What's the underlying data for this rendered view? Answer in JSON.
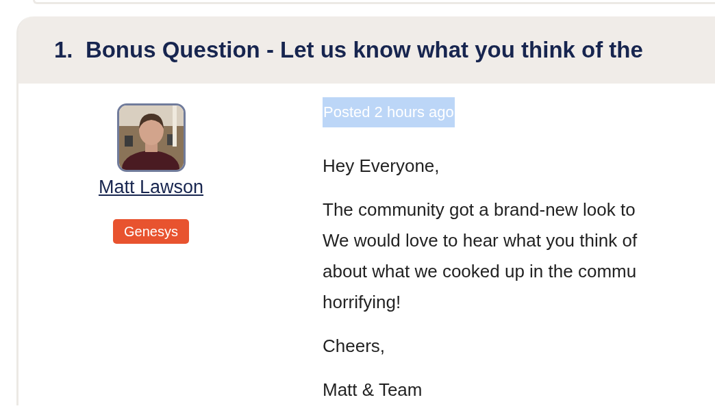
{
  "question": {
    "number": "1.",
    "title": "Bonus Question - Let us know what you think of the"
  },
  "author": {
    "name": "Matt Lawson",
    "badge": "Genesys"
  },
  "posted": {
    "text": "Posted 2 hours ago",
    "selected": true
  },
  "body": [
    {
      "lines": [
        "Hey Everyone,"
      ]
    },
    {
      "lines": [
        "The community got a brand-new look to",
        "We would love to hear what you think of",
        "about what we cooked up in the commu",
        "horrifying!"
      ]
    },
    {
      "lines": [
        "Cheers,"
      ]
    },
    {
      "lines": [
        "Matt & Team"
      ]
    }
  ]
}
